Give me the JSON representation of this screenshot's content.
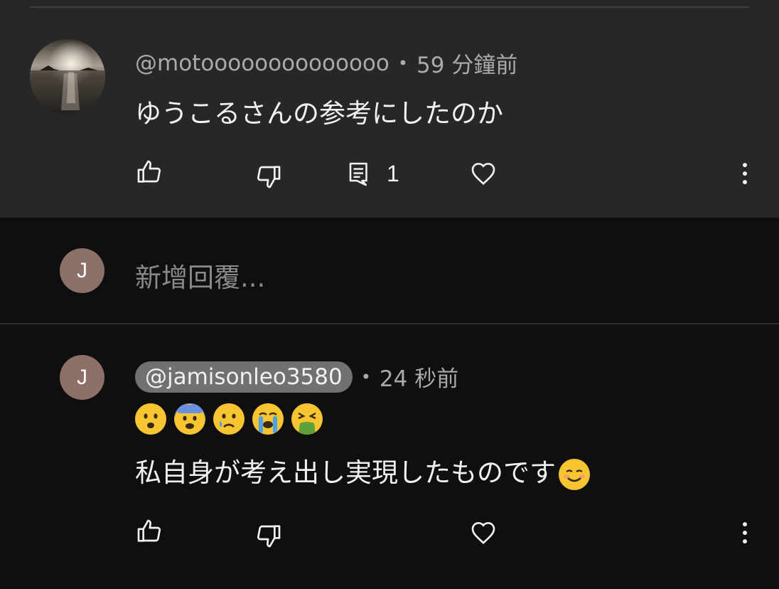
{
  "thread": {
    "parent": {
      "handle": "@motoooooooooooooo",
      "separator": "•",
      "time": "59 分鐘前",
      "text": "ゆうこるさんの参考にしたのか",
      "reply_count": "1",
      "avatar_icon": "sunset-photo-avatar"
    },
    "reply_composer": {
      "avatar_letter": "J",
      "placeholder": "新增回覆..."
    },
    "reply": {
      "avatar_letter": "J",
      "handle": "@jamisonleo3580",
      "separator": "•",
      "time": "24 秒前",
      "emojis": [
        "frowning-face-emoji",
        "fearful-face-emoji",
        "crying-face-emoji",
        "loudly-crying-face-emoji",
        "vomiting-face-emoji"
      ],
      "text": "私自身が考え出し実現したものです",
      "trailing_emoji": "smiling-face-emoji"
    }
  },
  "colors": {
    "card_bg": "#272727",
    "page_bg": "#0f0f0f",
    "avatar_letter_bg": "#8d7068",
    "handle_chip_bg": "#717171",
    "meta_text": "#aaaaaa",
    "emoji_yellow": "#f7c531"
  },
  "icons": [
    "like-icon",
    "dislike-icon",
    "reply-icon",
    "heart-icon",
    "more-vert-icon"
  ]
}
